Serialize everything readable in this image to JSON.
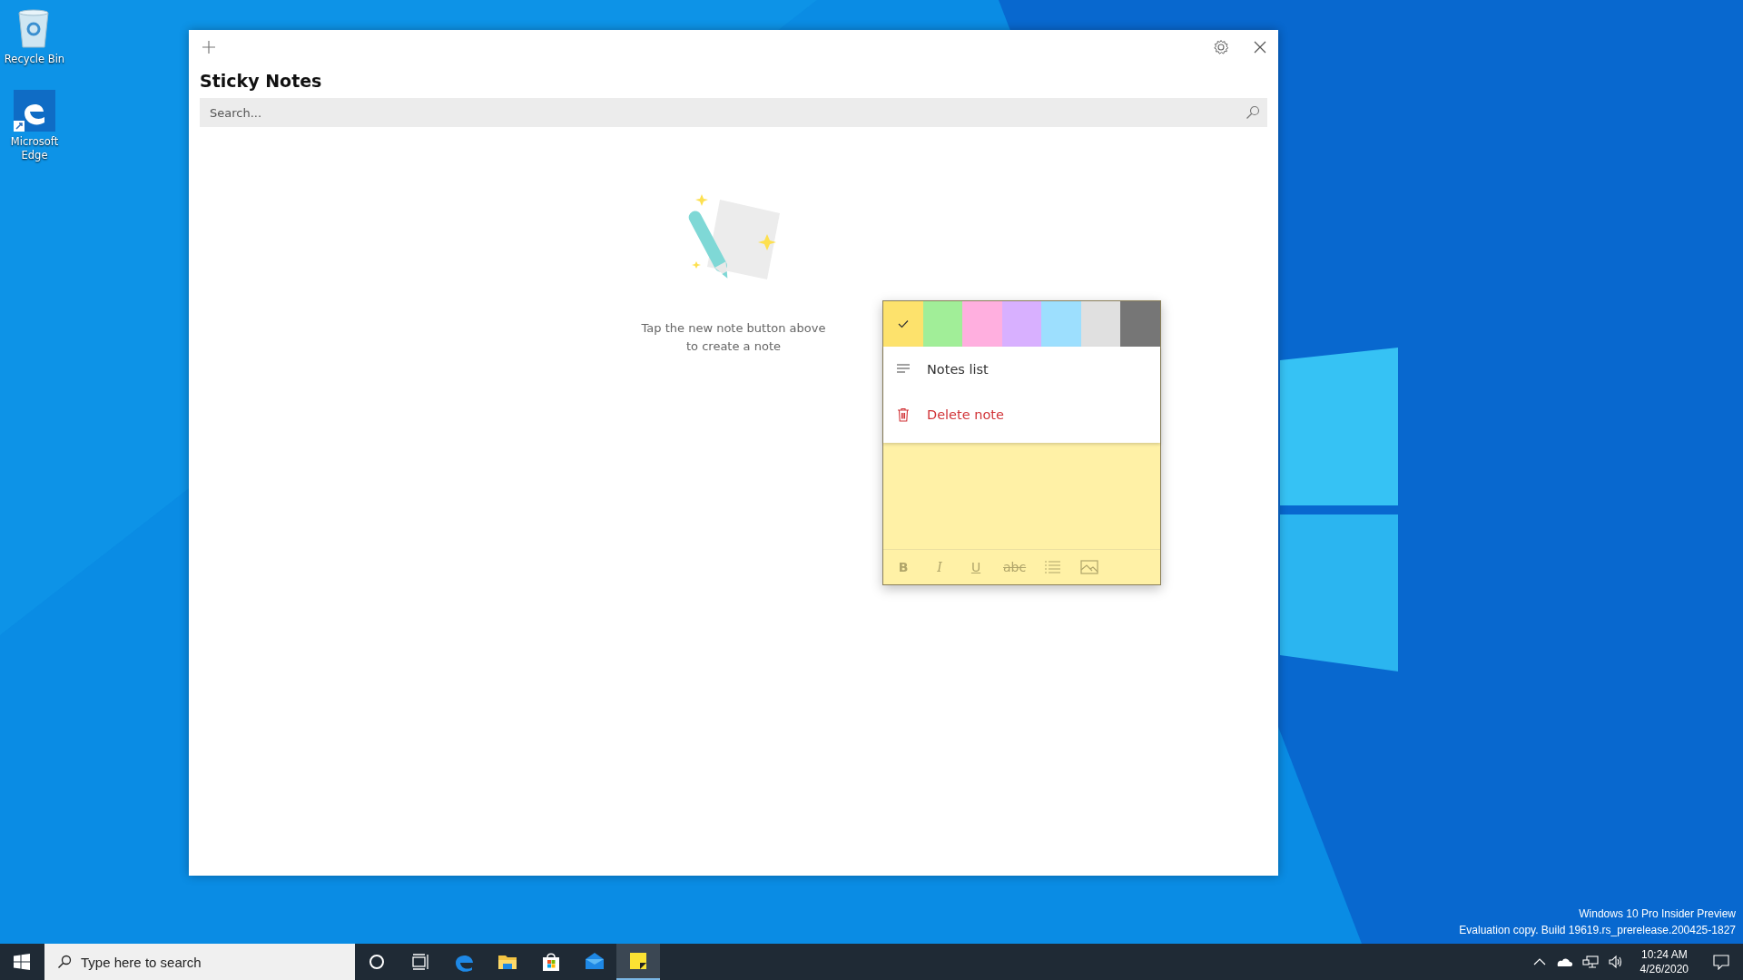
{
  "desktop_icons": [
    {
      "label": "Recycle Bin",
      "kind": "recycle"
    },
    {
      "label": "Microsoft Edge",
      "kind": "edge"
    }
  ],
  "app": {
    "title": "Sticky Notes",
    "search": {
      "placeholder": "Search..."
    },
    "empty_message": "Tap the new note button above to create a note"
  },
  "note": {
    "colors": [
      {
        "color": "#fde26c",
        "selected": true
      },
      {
        "color": "#a1ee98",
        "selected": false
      },
      {
        "color": "#ffafdf",
        "selected": false
      },
      {
        "color": "#d8b0ff",
        "selected": false
      },
      {
        "color": "#9ddffe",
        "selected": false
      },
      {
        "color": "#e0e0e0",
        "selected": false
      },
      {
        "color": "#767676",
        "selected": false
      }
    ],
    "menu": [
      {
        "label": "Notes list",
        "kind": "list"
      },
      {
        "label": "Delete note",
        "kind": "delete"
      }
    ],
    "format_tools": [
      {
        "kind": "bold",
        "label": "B"
      },
      {
        "kind": "italic",
        "label": "I"
      },
      {
        "kind": "underline",
        "label": "U"
      },
      {
        "kind": "strike",
        "label": "abc"
      },
      {
        "kind": "bullets"
      },
      {
        "kind": "image"
      }
    ]
  },
  "desktop_notice": [
    "Windows 10 Pro Insider Preview",
    "Evaluation copy. Build 19619.rs_prerelease.200425-1827"
  ],
  "taskbar": {
    "search": {
      "placeholder": "Type here to search"
    },
    "apps": [
      {
        "kind": "cortana",
        "active": false
      },
      {
        "kind": "taskview",
        "active": false
      },
      {
        "kind": "edge",
        "active": false
      },
      {
        "kind": "explorer",
        "active": false
      },
      {
        "kind": "store",
        "active": false
      },
      {
        "kind": "mail",
        "active": false
      },
      {
        "kind": "sticky",
        "active": true
      }
    ],
    "tray": {
      "time": "10:24 AM",
      "date": "4/26/2020"
    }
  }
}
